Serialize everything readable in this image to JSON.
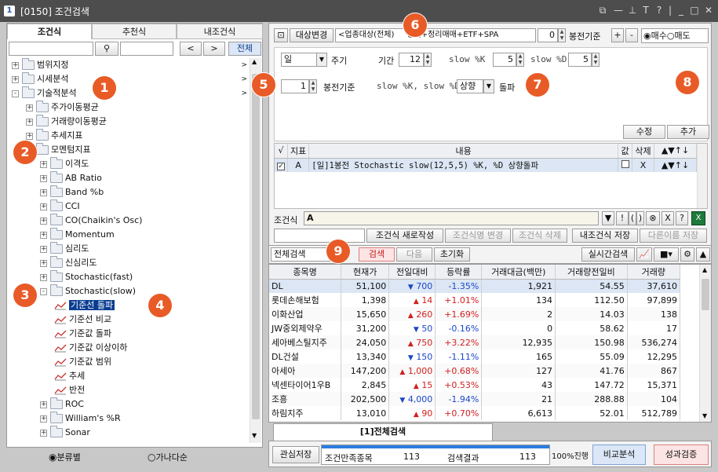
{
  "window": {
    "id": "[0150]",
    "title": "조건검색",
    "app_num": "1"
  },
  "left": {
    "tabs": [
      "조건식",
      "추천식",
      "내조건식"
    ],
    "all_button": "전체",
    "prev": "<",
    "next": ">",
    "tree": [
      {
        "label": "범위지정",
        "indent": 0,
        "type": "folder",
        "tog": "+",
        "arrow": true
      },
      {
        "label": "시세분석",
        "indent": 0,
        "type": "folder",
        "tog": "+",
        "arrow": true
      },
      {
        "label": "기술적분석",
        "indent": 0,
        "type": "folder",
        "tog": "-",
        "arrow": true
      },
      {
        "label": "주가이동평균",
        "indent": 1,
        "type": "folder",
        "tog": "+"
      },
      {
        "label": "거래량이동평균",
        "indent": 1,
        "type": "folder",
        "tog": "+"
      },
      {
        "label": "추세지표",
        "indent": 1,
        "type": "folder",
        "tog": "+"
      },
      {
        "label": "모멘텀지표",
        "indent": 1,
        "type": "folder",
        "tog": "-"
      },
      {
        "label": "이격도",
        "indent": 2,
        "type": "folder",
        "tog": "+"
      },
      {
        "label": "AB Ratio",
        "indent": 2,
        "type": "folder",
        "tog": "+"
      },
      {
        "label": "Band %b",
        "indent": 2,
        "type": "folder",
        "tog": "+"
      },
      {
        "label": "CCI",
        "indent": 2,
        "type": "folder",
        "tog": "+"
      },
      {
        "label": "CO(Chaikin's Osc)",
        "indent": 2,
        "type": "folder",
        "tog": "+"
      },
      {
        "label": "Momentum",
        "indent": 2,
        "type": "folder",
        "tog": "+"
      },
      {
        "label": "심리도",
        "indent": 2,
        "type": "folder",
        "tog": "+"
      },
      {
        "label": "신심리도",
        "indent": 2,
        "type": "folder",
        "tog": "+"
      },
      {
        "label": "Stochastic(fast)",
        "indent": 2,
        "type": "folder",
        "tog": "+"
      },
      {
        "label": "Stochastic(slow)",
        "indent": 2,
        "type": "folder",
        "tog": "-"
      },
      {
        "label": "기준선 돌파",
        "indent": 3,
        "type": "chart",
        "selected": true
      },
      {
        "label": "기준선 비교",
        "indent": 3,
        "type": "chart"
      },
      {
        "label": "기준값 돌파",
        "indent": 3,
        "type": "chart"
      },
      {
        "label": "기준값 이상이하",
        "indent": 3,
        "type": "chart"
      },
      {
        "label": "기준값 범위",
        "indent": 3,
        "type": "chart"
      },
      {
        "label": "추세",
        "indent": 3,
        "type": "chart"
      },
      {
        "label": "반전",
        "indent": 3,
        "type": "chart"
      },
      {
        "label": "ROC",
        "indent": 2,
        "type": "folder",
        "tog": "+"
      },
      {
        "label": "William's %R",
        "indent": 2,
        "type": "folder",
        "tog": "+"
      },
      {
        "label": "Sonar",
        "indent": 2,
        "type": "folder",
        "tog": "+"
      }
    ],
    "radio1": "분류별",
    "radio2": "가나다순"
  },
  "top": {
    "target_change": "대상변경",
    "target_text": "<업종대상(전체)",
    "target_text2": "정지+정리매매+ETF+SPA",
    "candle_value": "0",
    "candle_label": "봉전기준",
    "plus": "+",
    "minus": "-",
    "buy": "매수",
    "sell": "매도"
  },
  "params": {
    "period_select": "일",
    "period_label": "주기",
    "candle_value": "1",
    "candle_label": "봉전기준",
    "term_label": "기간",
    "term_value": "12",
    "slowk_label": "slow %K",
    "slowk_value": "5",
    "slowd_label": "slow %D",
    "slowd_value": "5",
    "cross_label": "slow %K, slow %D",
    "cross_select": "상향",
    "cross_suffix": "돌파",
    "modify": "수정",
    "add": "추가"
  },
  "cond_table": {
    "headers": [
      "√",
      "지표",
      "내용",
      "값",
      "삭제",
      "▲▼↑↓"
    ],
    "rows": [
      {
        "flag": "A",
        "content": "[일]1봉전 Stochastic slow(12,5,5) %K, %D 상향돌파",
        "del": "X",
        "arrows": "▲▼↑↓"
      }
    ]
  },
  "formula": {
    "label": "조건식",
    "value": "A",
    "ops": [
      "!",
      "(",
      ")",
      "⊗",
      "X",
      "?"
    ]
  },
  "actions": {
    "new": "조건식 새로작성",
    "change": "조건식명 변경",
    "delete": "조건식 삭제",
    "save": "내조건식 저장",
    "save_as": "다른이름 저장"
  },
  "search": {
    "scope": "전체검색",
    "search": "검색",
    "next": "다음",
    "reset": "초기화",
    "realtime": "실시간검색"
  },
  "results": {
    "headers": [
      "종목명",
      "현재가",
      "전일대비",
      "등락률",
      "거래대금(백만)",
      "거래량전일비",
      "거래량"
    ],
    "rows": [
      {
        "name": "DL",
        "price": "51,100",
        "dir": "down",
        "change": "700",
        "rate": "-1.35%",
        "amount": "1,921",
        "vol_ratio": "54.55",
        "volume": "37,610"
      },
      {
        "name": "롯데손해보험",
        "price": "1,398",
        "dir": "up",
        "change": "14",
        "rate": "+1.01%",
        "amount": "134",
        "vol_ratio": "112.50",
        "volume": "97,899"
      },
      {
        "name": "이화산업",
        "price": "15,650",
        "dir": "up",
        "change": "260",
        "rate": "+1.69%",
        "amount": "2",
        "vol_ratio": "14.03",
        "volume": "138"
      },
      {
        "name": "JW중외제약우",
        "price": "31,200",
        "dir": "down",
        "change": "50",
        "rate": "-0.16%",
        "amount": "0",
        "vol_ratio": "58.62",
        "volume": "17"
      },
      {
        "name": "세아베스틸지주",
        "price": "24,050",
        "dir": "up",
        "change": "750",
        "rate": "+3.22%",
        "amount": "12,935",
        "vol_ratio": "150.98",
        "volume": "536,274"
      },
      {
        "name": "DL건설",
        "price": "13,340",
        "dir": "down",
        "change": "150",
        "rate": "-1.11%",
        "amount": "165",
        "vol_ratio": "55.09",
        "volume": "12,295"
      },
      {
        "name": "아세아",
        "price": "147,200",
        "dir": "up",
        "change": "1,000",
        "rate": "+0.68%",
        "amount": "127",
        "vol_ratio": "41.76",
        "volume": "867"
      },
      {
        "name": "넥센타이어1우B",
        "price": "2,845",
        "dir": "up",
        "change": "15",
        "rate": "+0.53%",
        "amount": "43",
        "vol_ratio": "147.72",
        "volume": "15,371"
      },
      {
        "name": "조흥",
        "price": "202,500",
        "dir": "down",
        "change": "4,000",
        "rate": "-1.94%",
        "amount": "21",
        "vol_ratio": "288.88",
        "volume": "104"
      },
      {
        "name": "하림지주",
        "price": "13,010",
        "dir": "up",
        "change": "90",
        "rate": "+0.70%",
        "amount": "6,613",
        "vol_ratio": "52.01",
        "volume": "512,789"
      }
    ]
  },
  "bottom": {
    "tab": "[1]전체검색",
    "watch_save": "관심저장",
    "match_label": "조건만족종목",
    "match_value": "113",
    "result_label": "검색결과",
    "result_value": "113",
    "progress": "100%진행",
    "progress_fraction": 1.0,
    "compare": "비교분석",
    "verify": "성과검증"
  },
  "badges": [
    "1",
    "2",
    "3",
    "4",
    "5",
    "6",
    "7",
    "8",
    "9"
  ],
  "colors": {
    "badge": "#e85b27",
    "selected": "#0a3d91",
    "up": "#d11f1f",
    "down": "#1c47c9",
    "progress": "#2a7de1"
  }
}
